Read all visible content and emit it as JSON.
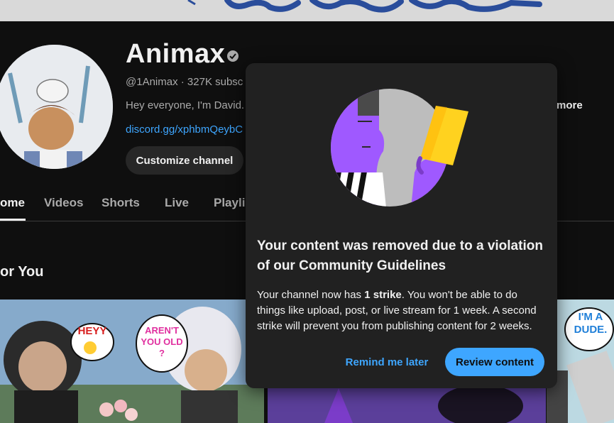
{
  "banner": {
    "description_hidden": ""
  },
  "channel": {
    "name": "Animax",
    "handle_line": "@1Animax · 327K subsc",
    "description": "Hey everyone, I'm David.",
    "more_label": "more",
    "link": "discord.gg/xphbmQeybC",
    "customize_label": "Customize channel"
  },
  "tabs": [
    {
      "label": "ome"
    },
    {
      "label": "Videos"
    },
    {
      "label": "Shorts"
    },
    {
      "label": "Live"
    },
    {
      "label": "Playli"
    }
  ],
  "section": {
    "title": "or You"
  },
  "thumbnails": {
    "t1_bubble1": "HEYY",
    "t1_bubble2": "AREN'T YOU OLD ?",
    "t3_bubble": "I'M A DUDE."
  },
  "dialog": {
    "title": "Your content was removed due to a violation of our Community Guidelines",
    "body_prefix": "Your channel now has ",
    "body_strike": "1 strike",
    "body_suffix": ". You won't be able to do things like upload, post, or live stream for 1 week. A second strike will prevent you from publishing content for 2 weeks.",
    "remind_label": "Remind me later",
    "review_label": "Review content"
  },
  "colors": {
    "accent": "#3ea6ff",
    "background": "#0f0f0f",
    "dialog_bg": "#212121",
    "illustration_purple": "#9f59ff",
    "illustration_yellow": "#ffd21f"
  }
}
